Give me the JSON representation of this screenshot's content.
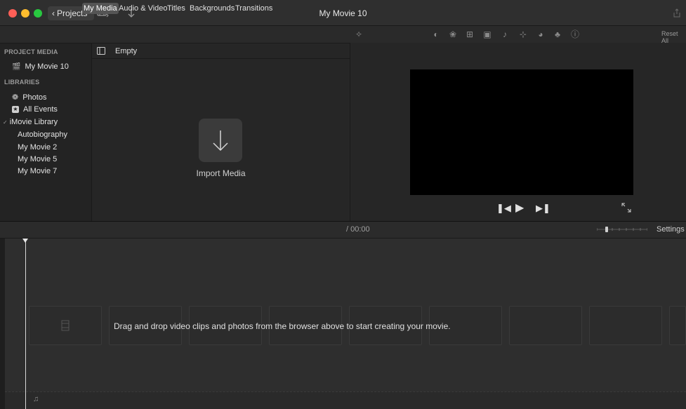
{
  "window": {
    "title": "My Movie 10",
    "projects_label": "Projects"
  },
  "tabs": [
    {
      "label": "My Media",
      "active": true
    },
    {
      "label": "Audio & Video",
      "active": false
    },
    {
      "label": "Titles",
      "active": false
    },
    {
      "label": "Backgrounds",
      "active": false
    },
    {
      "label": "Transitions",
      "active": false
    }
  ],
  "sidebar": {
    "project_media_heading": "PROJECT MEDIA",
    "project_item": "My Movie 10",
    "libraries_heading": "LIBRARIES",
    "photos": "Photos",
    "all_events": "All Events",
    "library_name": "iMovie Library",
    "library_items": [
      "Autobiography",
      "My Movie 2",
      "My Movie 5",
      "My Movie 7"
    ]
  },
  "media": {
    "header_label": "Empty",
    "import_label": "Import Media"
  },
  "viewer": {
    "reset_all": "Reset All"
  },
  "timeline": {
    "timecode": "/ 00:00",
    "settings_label": "Settings",
    "drop_hint": "Drag and drop video clips and photos from the browser above to start creating your movie."
  },
  "colors": {
    "close": "#ff5f57",
    "minimize": "#febc2e",
    "zoom": "#28c840",
    "active_tab": "#555555"
  }
}
